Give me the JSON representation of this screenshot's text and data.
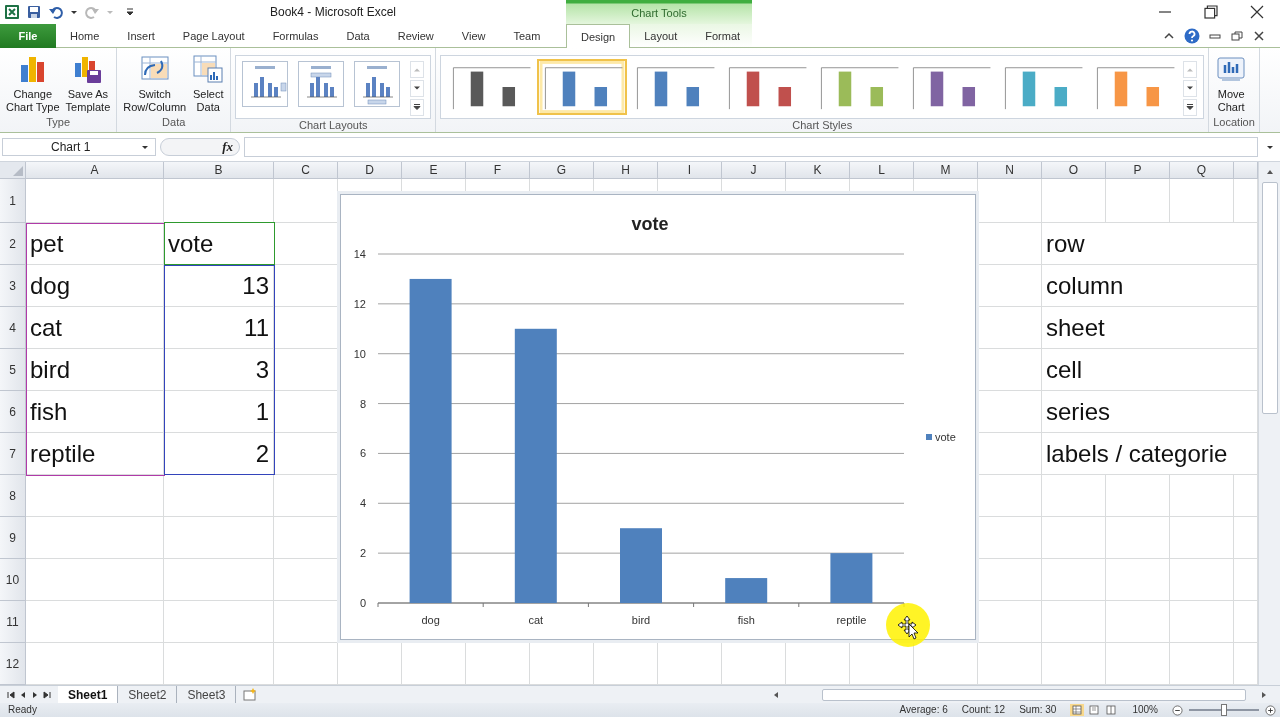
{
  "window": {
    "title": "Book4  -  Microsoft Excel",
    "context_title": "Chart Tools"
  },
  "ribbon_tabs": [
    {
      "label": "File",
      "kind": "file",
      "selected": false
    },
    {
      "label": "Home",
      "kind": "main",
      "selected": false
    },
    {
      "label": "Insert",
      "kind": "main",
      "selected": false
    },
    {
      "label": "Page Layout",
      "kind": "main",
      "selected": false
    },
    {
      "label": "Formulas",
      "kind": "main",
      "selected": false
    },
    {
      "label": "Data",
      "kind": "main",
      "selected": false
    },
    {
      "label": "Review",
      "kind": "main",
      "selected": false
    },
    {
      "label": "View",
      "kind": "main",
      "selected": false
    },
    {
      "label": "Team",
      "kind": "main",
      "selected": false
    },
    {
      "label": "Design",
      "kind": "context",
      "selected": true
    },
    {
      "label": "Layout",
      "kind": "context",
      "selected": false
    },
    {
      "label": "Format",
      "kind": "context",
      "selected": false
    }
  ],
  "ribbon_groups": [
    {
      "label": "Type",
      "kind": "buttons",
      "buttons": [
        {
          "label": [
            "Change",
            "Chart Type"
          ]
        },
        {
          "label": [
            "Save As",
            "Template"
          ]
        }
      ]
    },
    {
      "label": "Data",
      "kind": "buttons",
      "buttons": [
        {
          "label": [
            "Switch",
            "Row/Column"
          ]
        },
        {
          "label": [
            "Select",
            "Data"
          ]
        }
      ]
    },
    {
      "label": "Chart Layouts",
      "kind": "layouts"
    },
    {
      "label": "Chart Styles",
      "kind": "styles",
      "styles": [
        {
          "color": "#595959",
          "selected": false
        },
        {
          "color": "#4f81bd",
          "selected": true
        },
        {
          "color": "#4f81bd",
          "selected": false
        },
        {
          "color": "#c0504d",
          "selected": false
        },
        {
          "color": "#9bbb59",
          "selected": false
        },
        {
          "color": "#8064a2",
          "selected": false
        },
        {
          "color": "#4bacc6",
          "selected": false
        },
        {
          "color": "#f79646",
          "selected": false
        }
      ]
    },
    {
      "label": "Location",
      "kind": "buttons",
      "buttons": [
        {
          "label": [
            "Move",
            "Chart"
          ]
        }
      ]
    }
  ],
  "formula_bar": {
    "name_box": "Chart 1",
    "function_label": "fx"
  },
  "sheet": {
    "columns": [
      "A",
      "B",
      "C",
      "D",
      "E",
      "F",
      "G",
      "H",
      "I",
      "J",
      "K",
      "L",
      "M",
      "N",
      "O",
      "P",
      "Q"
    ],
    "rows": [
      {
        "label": "1"
      },
      {
        "label": "2",
        "cells": [
          {
            "text": "pet",
            "kind": "text"
          },
          {
            "text": "vote",
            "kind": "text"
          }
        ],
        "note": "row"
      },
      {
        "label": "3",
        "cells": [
          {
            "text": "dog",
            "kind": "text"
          },
          {
            "text": "13",
            "kind": "number"
          }
        ],
        "note": "column"
      },
      {
        "label": "4",
        "cells": [
          {
            "text": "cat",
            "kind": "text"
          },
          {
            "text": "11",
            "kind": "number"
          }
        ],
        "note": "sheet"
      },
      {
        "label": "5",
        "cells": [
          {
            "text": "bird",
            "kind": "text"
          },
          {
            "text": "3",
            "kind": "number"
          }
        ],
        "note": "cell"
      },
      {
        "label": "6",
        "cells": [
          {
            "text": "fish",
            "kind": "text"
          },
          {
            "text": "1",
            "kind": "number"
          }
        ],
        "note": "series"
      },
      {
        "label": "7",
        "cells": [
          {
            "text": "reptile",
            "kind": "text"
          },
          {
            "text": "2",
            "kind": "number"
          }
        ],
        "note": "labels / categorie"
      },
      {
        "label": "8"
      },
      {
        "label": "9"
      },
      {
        "label": "10"
      },
      {
        "label": "11"
      },
      {
        "label": "12"
      }
    ]
  },
  "chart": {
    "chart_data": {
      "type": "bar",
      "title": "vote",
      "categories": [
        "dog",
        "cat",
        "bird",
        "fish",
        "reptile"
      ],
      "series": [
        {
          "name": "vote",
          "color": "#4f81bd",
          "values": [
            13,
            11,
            3,
            1,
            2
          ]
        }
      ],
      "ylim": [
        0,
        14
      ],
      "grid": true,
      "yticks": [
        {
          "value": 0,
          "label": "0"
        },
        {
          "value": 2,
          "label": "2"
        },
        {
          "value": 4,
          "label": "4"
        },
        {
          "value": 6,
          "label": "6"
        },
        {
          "value": 8,
          "label": "8"
        },
        {
          "value": 10,
          "label": "10"
        },
        {
          "value": 12,
          "label": "12"
        },
        {
          "value": 14,
          "label": "14"
        }
      ]
    }
  },
  "sheet_tabs": [
    {
      "label": "Sheet1",
      "selected": true
    },
    {
      "label": "Sheet2",
      "selected": false
    },
    {
      "label": "Sheet3",
      "selected": false
    }
  ],
  "status_bar": {
    "mode": "Ready",
    "average": "Average: 6",
    "count": "Count: 12",
    "sum": "Sum: 30",
    "views": [
      {
        "selected": true
      },
      {
        "selected": false
      },
      {
        "selected": false
      }
    ],
    "zoom": "100%",
    "zoom_slider": {
      "level": 0.5
    }
  }
}
